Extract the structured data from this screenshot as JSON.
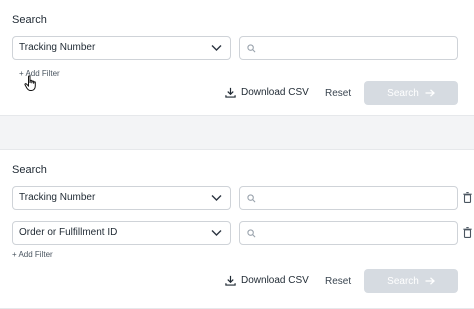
{
  "panel_top": {
    "title": "Search",
    "filter_select": "Tracking Number",
    "add_filter": "+ Add Filter",
    "download": "Download CSV",
    "reset": "Reset",
    "search": "Search"
  },
  "panel_bottom": {
    "title": "Search",
    "filters": [
      {
        "select": "Tracking Number"
      },
      {
        "select": "Order or Fulfillment ID"
      }
    ],
    "add_filter": "+ Add Filter",
    "download": "Download CSV",
    "reset": "Reset",
    "search": "Search"
  },
  "colors": {
    "disabled_button": "#d6dbe1",
    "border": "#cfd3d8"
  },
  "icons": [
    "chevron-down-icon",
    "search-icon",
    "download-icon",
    "arrow-right-icon",
    "trash-icon",
    "hand-cursor-icon"
  ]
}
